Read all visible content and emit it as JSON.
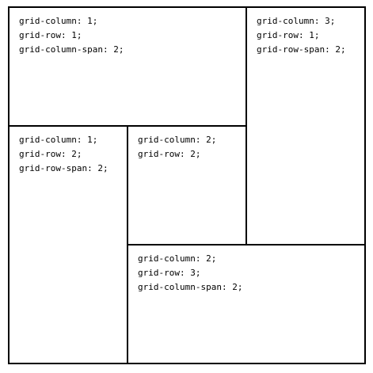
{
  "cells": [
    {
      "lines": [
        "grid-column: 1;",
        "grid-row: 1;",
        "grid-column-span: 2;"
      ]
    },
    {
      "lines": [
        "grid-column: 3;",
        "grid-row: 1;",
        "grid-row-span: 2;"
      ]
    },
    {
      "lines": [
        "grid-column: 1;",
        "grid-row: 2;",
        "grid-row-span: 2;"
      ]
    },
    {
      "lines": [
        "grid-column: 2;",
        "grid-row: 2;"
      ]
    },
    {
      "lines": [
        "grid-column: 2;",
        "grid-row: 3;",
        "grid-column-span: 2;"
      ]
    }
  ],
  "colors": {
    "border": "#000000",
    "background": "#ffffff",
    "text": "#000000"
  }
}
